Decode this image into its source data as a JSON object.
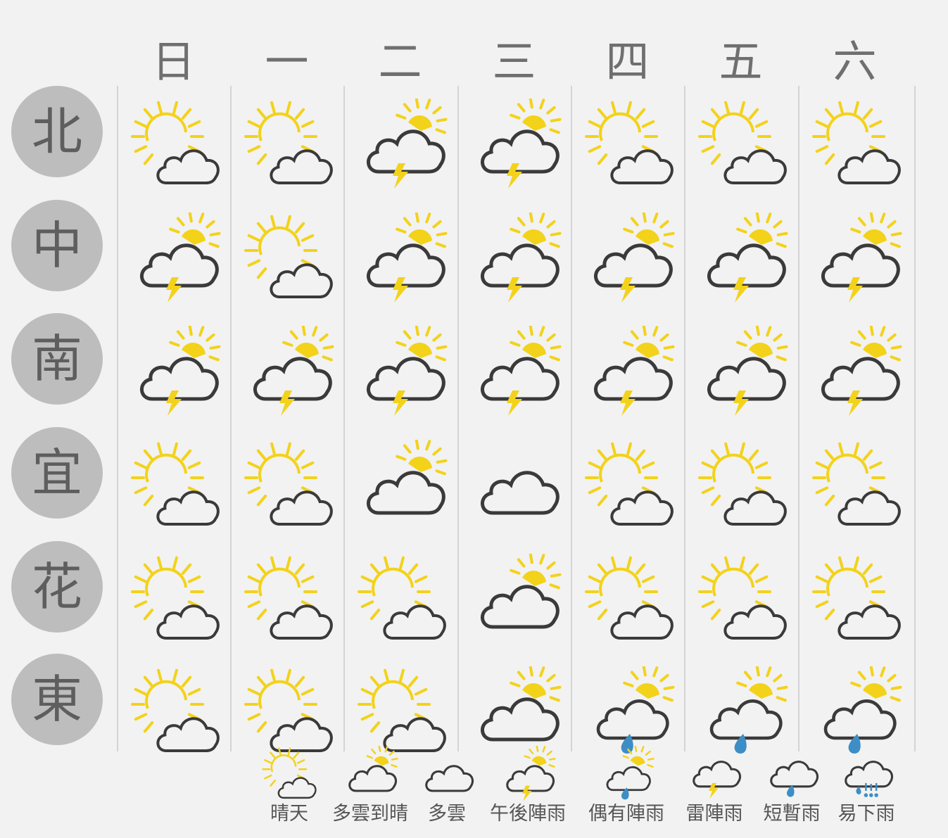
{
  "days": [
    "日",
    "一",
    "二",
    "三",
    "四",
    "五",
    "六"
  ],
  "colors": {
    "sun": "#f3d21a",
    "cloud_outline": "#3a3a3a",
    "lightning": "#f3d21a",
    "rain": "#3d8ec6",
    "region_circle": "#bdbdbd",
    "text": "#6f6f6f"
  },
  "regions": [
    {
      "name": "北",
      "forecast": [
        "sunny",
        "sunny",
        "afternoon-showers",
        "afternoon-showers",
        "sunny",
        "sunny",
        "sunny"
      ]
    },
    {
      "name": "中",
      "forecast": [
        "afternoon-showers",
        "sunny",
        "afternoon-showers",
        "afternoon-showers",
        "afternoon-showers",
        "afternoon-showers",
        "afternoon-showers"
      ]
    },
    {
      "name": "南",
      "forecast": [
        "afternoon-showers",
        "afternoon-showers",
        "afternoon-showers",
        "afternoon-showers",
        "afternoon-showers",
        "afternoon-showers",
        "afternoon-showers"
      ]
    },
    {
      "name": "宜",
      "forecast": [
        "sunny",
        "sunny",
        "cloudy-clearing",
        "cloudy",
        "sunny",
        "sunny",
        "sunny"
      ]
    },
    {
      "name": "花",
      "forecast": [
        "sunny",
        "sunny",
        "sunny",
        "cloudy-clearing",
        "sunny",
        "sunny",
        "sunny"
      ]
    },
    {
      "name": "東",
      "forecast": [
        "sunny",
        "sunny",
        "sunny",
        "cloudy-clearing",
        "occasional-showers",
        "occasional-showers",
        "occasional-showers"
      ]
    }
  ],
  "legend": [
    {
      "icon": "sunny",
      "label": "晴天"
    },
    {
      "icon": "cloudy-clearing",
      "label": "多雲到晴"
    },
    {
      "icon": "cloudy",
      "label": "多雲"
    },
    {
      "icon": "afternoon-showers",
      "label": "午後陣雨"
    },
    {
      "icon": "occasional-showers",
      "label": "偶有陣雨"
    },
    {
      "icon": "thunder-showers",
      "label": "雷陣雨"
    },
    {
      "icon": "brief-rain",
      "label": "短暫雨"
    },
    {
      "icon": "likely-rain",
      "label": "易下雨"
    }
  ]
}
